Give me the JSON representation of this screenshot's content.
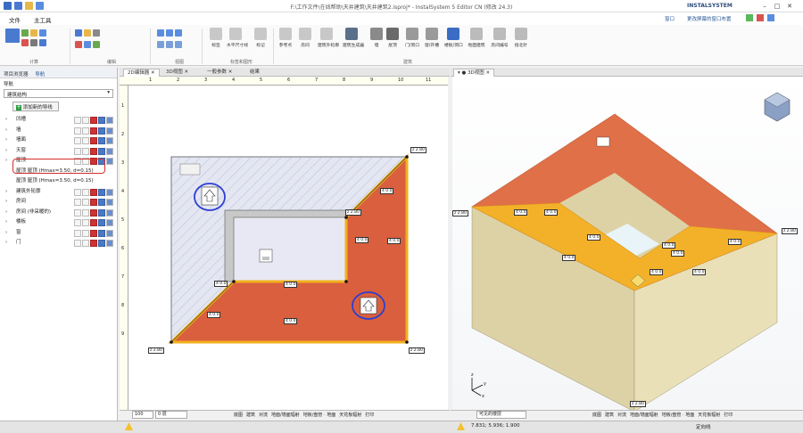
{
  "app": {
    "title": "F:\\工作文件\\在线帮助\\天井建筑\\天井建筑2.isproj* - InstalSystem 5 Editor CN (修改 24.3)",
    "brand": "INSTALSYSTEM"
  },
  "menu": {
    "file": "文件",
    "main_tools": "主工具",
    "window": "窗口",
    "hidden_window": "更改屏幕的窗口布置"
  },
  "ribbon": {
    "groups": {
      "calc": "计算",
      "edit": "编辑",
      "view": "视图",
      "building_graphics": "标签和图形",
      "building": "建筑"
    },
    "buttons": [
      "标签",
      "水平尺寸线",
      "标记",
      "参考点",
      "房间",
      "建筑外轮廓",
      "建筑生成器",
      "墙",
      "屋顶",
      "门/洞口",
      "窗/开槽",
      "楼板/洞口",
      "地面建筑",
      "房间编号",
      "指北针"
    ]
  },
  "left_panel": {
    "tab_project": "项目浏览器",
    "tab_nav": "导航",
    "section_label": "导航",
    "dropdown_value": "建筑结构",
    "add_button": "添加新的导线",
    "tree": [
      "凹槽",
      "墙",
      "墙面",
      "天窗",
      "屋顶",
      "屋顶 屋顶 (Hmax=3.50, d=0.15)",
      "屋顶 屋顶 (Hmax=3.50, d=0.15)",
      "建筑外轮廓",
      "房间",
      "房间 (非采暖的)",
      "楼板",
      "窗",
      "门"
    ]
  },
  "doc_tabs": {
    "tab_2d": "2D编辑器",
    "tab_3d_small": "3D视图",
    "tab_general": "一般参数",
    "tab_results": "结果",
    "tab_3d": "3D视图"
  },
  "ruler": {
    "h": [
      "1",
      "2",
      "3",
      "4",
      "5",
      "6",
      "7",
      "8",
      "9",
      "10",
      "11"
    ],
    "v": [
      "1",
      "2",
      "3",
      "4",
      "5",
      "6",
      "7",
      "8",
      "9"
    ]
  },
  "drawing": {
    "z_top_right": "2.80",
    "z_bottom_left": "2.80",
    "z_bottom_right": "2.80",
    "z_inner": "2.80",
    "slope": "0.0"
  },
  "view3d": {
    "z_left": "2.80",
    "z_right": "2.80",
    "z_bottom": "2.80",
    "slope": "0.0",
    "axis_x": "x",
    "axis_y": "y",
    "axis_z": "z"
  },
  "bottom2d": {
    "zoom": "100",
    "floor": "0 层",
    "tabs": [
      "底图",
      "建筑",
      "对流",
      "地面/墙面辐射",
      "地板/盘管 · 地面",
      "天花板辐射",
      "打印"
    ]
  },
  "bottom3d": {
    "layer": "可见的楼层",
    "tabs": [
      "底图",
      "建筑",
      "对流",
      "地面/墙面辐射",
      "地板/盘管 · 地面",
      "天花板辐射",
      "打印"
    ]
  },
  "status": {
    "coords": "7.831; 5.936; 1.900",
    "right": "定向线"
  },
  "colors": {
    "roof_orange": "#dc6b4a",
    "roof_yellow": "#f3b12a",
    "wall": "#e8dcb0",
    "accent": "#2b5797",
    "ellipse": "#2c3ed1"
  }
}
